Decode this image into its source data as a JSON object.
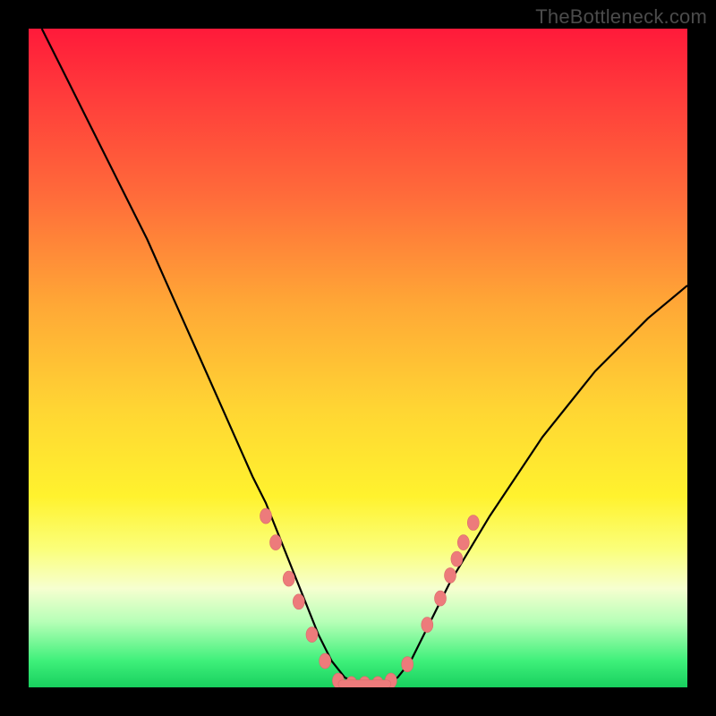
{
  "watermark": "TheBottleneck.com",
  "colors": {
    "curve": "#000000",
    "marker_fill": "#ed7b7b",
    "marker_stroke": "#d96b6b"
  },
  "chart_data": {
    "type": "line",
    "title": "",
    "xlabel": "",
    "ylabel": "",
    "x_range": [
      0,
      100
    ],
    "y_range": [
      0,
      100
    ],
    "series": [
      {
        "name": "bottleneck-curve",
        "x": [
          2,
          6,
          10,
          14,
          18,
          22,
          26,
          30,
          34,
          36,
          38,
          40,
          42,
          44,
          46,
          48,
          50,
          52,
          54,
          56,
          58,
          60,
          64,
          70,
          78,
          86,
          94,
          100
        ],
        "y": [
          100,
          92,
          84,
          76,
          68,
          59,
          50,
          41,
          32,
          28,
          23,
          18,
          13,
          8,
          4,
          1.5,
          0.5,
          0.5,
          0.5,
          1.5,
          4,
          8,
          16,
          26,
          38,
          48,
          56,
          61
        ]
      }
    ],
    "markers": {
      "name": "highlight-points",
      "points": [
        {
          "x": 36.0,
          "y": 26.0
        },
        {
          "x": 37.5,
          "y": 22.0
        },
        {
          "x": 39.5,
          "y": 16.5
        },
        {
          "x": 41.0,
          "y": 13.0
        },
        {
          "x": 43.0,
          "y": 8.0
        },
        {
          "x": 45.0,
          "y": 4.0
        },
        {
          "x": 47.0,
          "y": 1.0
        },
        {
          "x": 49.0,
          "y": 0.5
        },
        {
          "x": 51.0,
          "y": 0.5
        },
        {
          "x": 53.0,
          "y": 0.5
        },
        {
          "x": 55.0,
          "y": 1.0
        },
        {
          "x": 57.5,
          "y": 3.5
        },
        {
          "x": 60.5,
          "y": 9.5
        },
        {
          "x": 62.5,
          "y": 13.5
        },
        {
          "x": 64.0,
          "y": 17.0
        },
        {
          "x": 65.0,
          "y": 19.5
        },
        {
          "x": 66.0,
          "y": 22.0
        },
        {
          "x": 67.5,
          "y": 25.0
        }
      ]
    },
    "bottom_bar": {
      "x0": 47.0,
      "x1": 55.0,
      "y": 0.5
    }
  }
}
